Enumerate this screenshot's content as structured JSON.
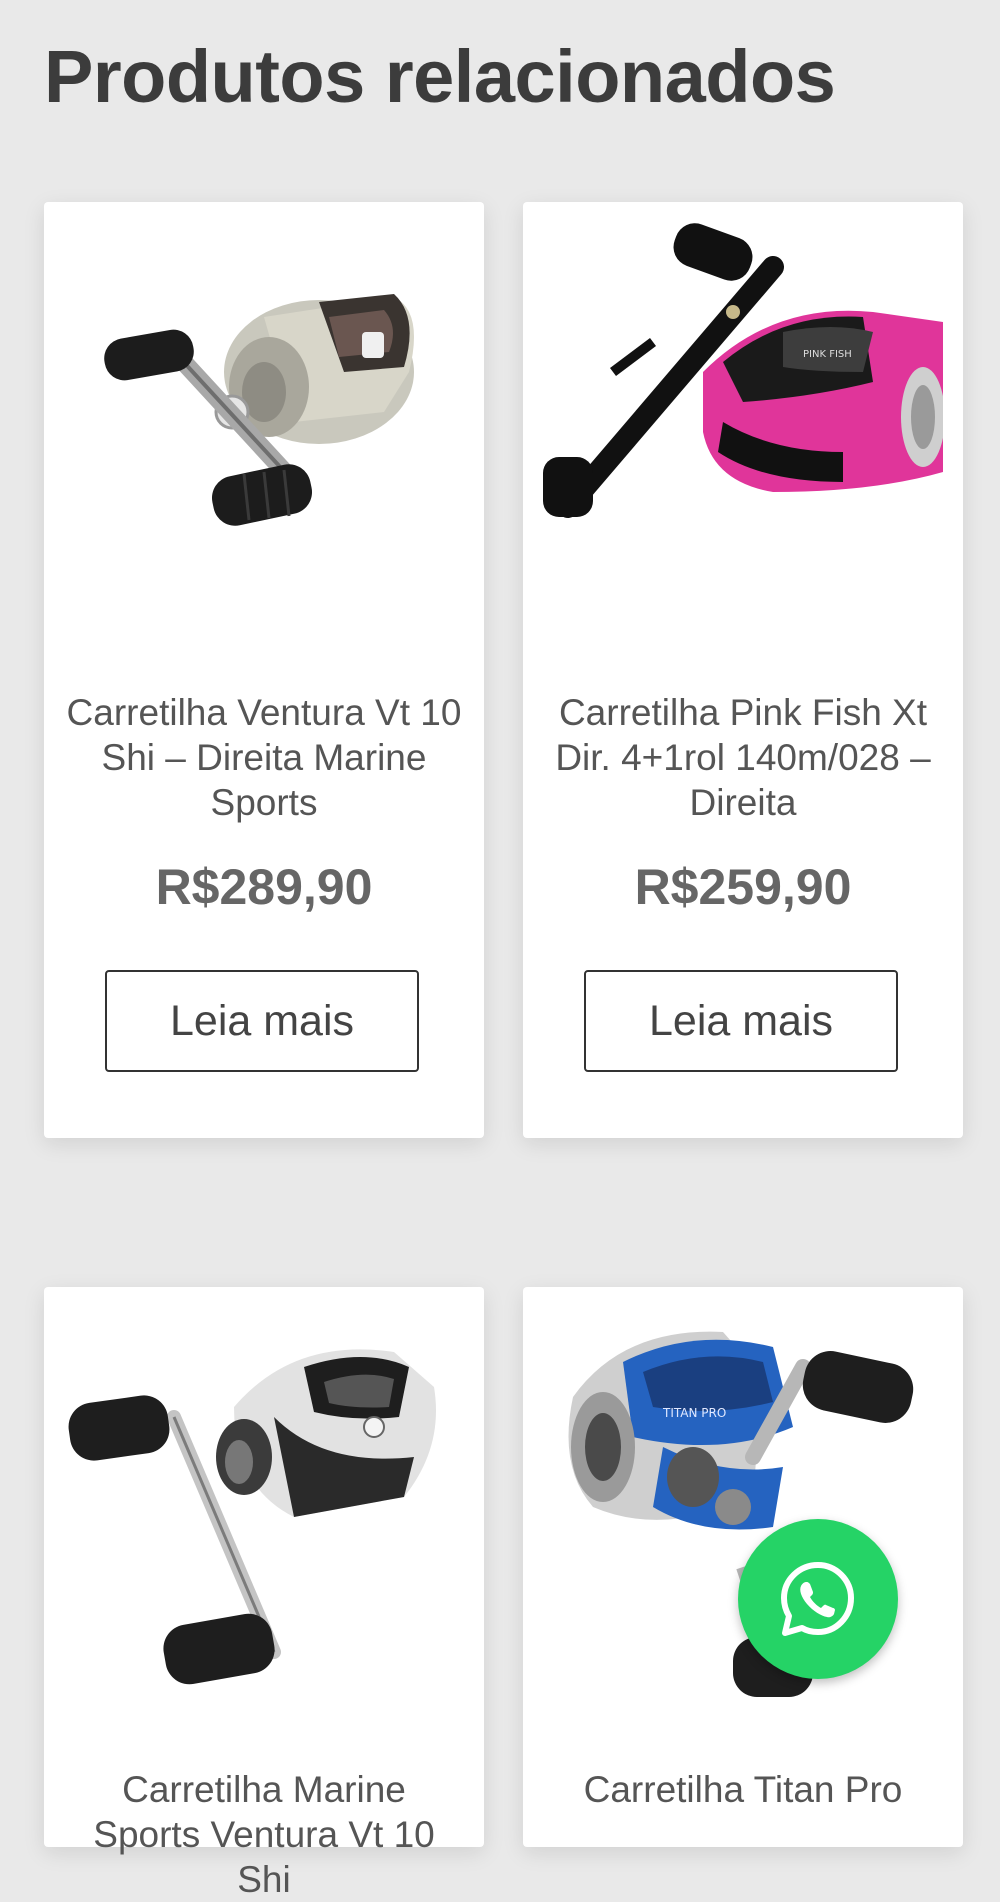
{
  "section": {
    "heading": "Produtos relacionados"
  },
  "products": [
    {
      "title": "Carretilha Ventura Vt 10 Shi – Direita Marine Sports",
      "price": "R$289,90",
      "button_label": "Leia mais",
      "image_icon": "baitcaster-reel-silver-gold"
    },
    {
      "title": "Carretilha Pink Fish Xt Dir. 4+1rol 140m/028 – Direita",
      "price": "R$259,90",
      "button_label": "Leia mais",
      "image_icon": "baitcaster-reel-pink"
    },
    {
      "title": "Carretilha Marine Sports Ventura Vt 10 Shi",
      "image_icon": "baitcaster-reel-silver"
    },
    {
      "title": "Carretilha Titan Pro",
      "image_icon": "baitcaster-reel-blue"
    }
  ],
  "whatsapp": {
    "icon": "whatsapp-icon",
    "color": "#25d366"
  },
  "colors": {
    "background": "#e9e9e9",
    "card": "#ffffff",
    "pink_accent": "#e0359a",
    "blue_accent": "#2563c0"
  }
}
